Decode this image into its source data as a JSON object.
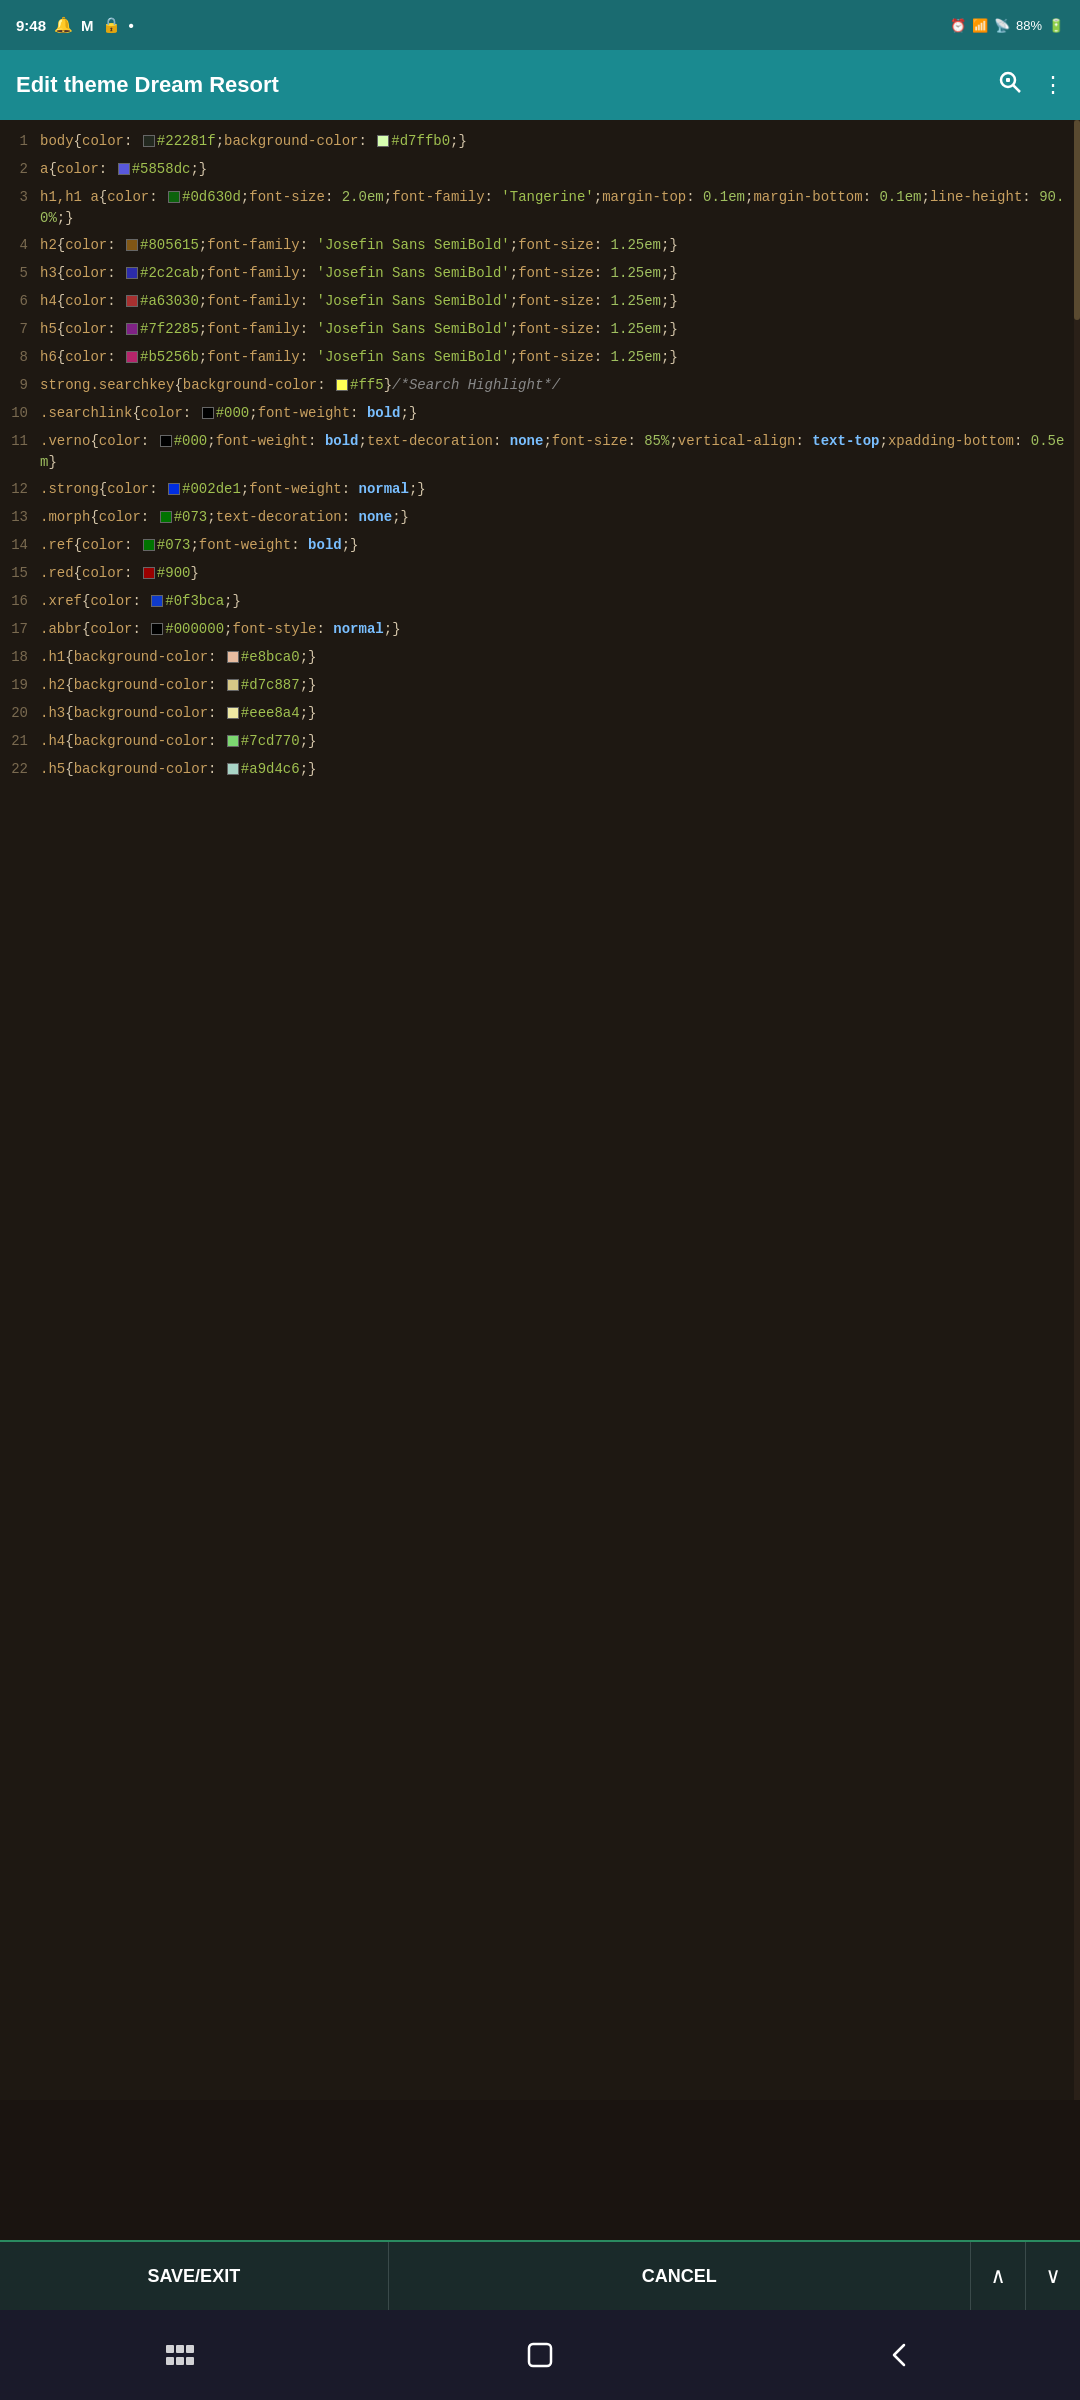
{
  "statusBar": {
    "time": "9:48",
    "battery": "88%",
    "icons": [
      "alarm",
      "wifi",
      "signal"
    ]
  },
  "header": {
    "title": "Edit theme Dream Resort",
    "searchIcon": "🔍",
    "menuIcon": "⋮"
  },
  "toolbar": {
    "saveLabel": "SAVE/EXIT",
    "cancelLabel": "CANCEL",
    "upIcon": "^",
    "downIcon": "v"
  },
  "lines": [
    {
      "num": "1",
      "swatches": [
        {
          "color": "#22281f",
          "pos": 0
        },
        {
          "color": "#d7ffb0",
          "pos": 1
        }
      ],
      "text": "body{color: #22281f;background-color: #d7ffb0;}"
    },
    {
      "num": "2",
      "swatches": [
        {
          "color": "#5858dc",
          "pos": 0
        }
      ],
      "text": "a{color: #5858dc;}"
    },
    {
      "num": "3",
      "swatches": [
        {
          "color": "#0d630d",
          "pos": 0
        }
      ],
      "text": "h1,h1 a{color: #0d630d;font-size:2.0em;font-family:'Tangerine';margin-top:0.1em;margin-bottom:0.1em;line-height:90.0%;}"
    },
    {
      "num": "4",
      "swatches": [
        {
          "color": "#805615",
          "pos": 0
        }
      ],
      "text": "h2{color: #805615;font-family:'Josefin Sans SemiBold';font-size:1.25em;}"
    },
    {
      "num": "5",
      "swatches": [
        {
          "color": "#2c2cab",
          "pos": 0
        }
      ],
      "text": "h3{color: #2c2cab;font-family:'Josefin Sans SemiBold';font-size:1.25em;}"
    },
    {
      "num": "6",
      "swatches": [
        {
          "color": "#a63030",
          "pos": 0
        }
      ],
      "text": "h4{color: #a63030;font-family:'Josefin Sans SemiBold';font-size:1.25em;}"
    },
    {
      "num": "7",
      "swatches": [
        {
          "color": "#7f2285",
          "pos": 0
        }
      ],
      "text": "h5{color: #7f2285;font-family:'Josefin Sans SemiBold';font-size:1.25em;}"
    },
    {
      "num": "8",
      "swatches": [
        {
          "color": "#b5256b",
          "pos": 0
        }
      ],
      "text": "h6{color: #b5256b;font-family:'Josefin Sans SemiBold';font-size:1.25em;}"
    },
    {
      "num": "9",
      "swatches": [
        {
          "color": "#ffff55",
          "pos": 0
        }
      ],
      "text": "strong.searchkey{background-color: #ff5}/*Search Highlight*/"
    },
    {
      "num": "10",
      "swatches": [
        {
          "color": "#000000",
          "pos": 0
        }
      ],
      "text": ".searchlink{color: #000;font-weight:bold;}"
    },
    {
      "num": "11",
      "swatches": [
        {
          "color": "#000000",
          "pos": 0
        }
      ],
      "text": ".verno{color: #000;font-weight:bold;text-decoration:none;font-size:85%;vertical-align:text-top;xpadding-bottom:0.5em}"
    },
    {
      "num": "12",
      "swatches": [
        {
          "color": "#002de1",
          "pos": 0
        }
      ],
      "text": ".strong{color: #002de1;font-weight:normal;}"
    },
    {
      "num": "13",
      "swatches": [
        {
          "color": "#007300",
          "pos": 0
        }
      ],
      "text": ".morph{color: #073;text-decoration:none;}"
    },
    {
      "num": "14",
      "swatches": [
        {
          "color": "#007300",
          "pos": 0
        }
      ],
      "text": ".ref{color: #073;font-weight:bold;}"
    },
    {
      "num": "15",
      "swatches": [
        {
          "color": "#990000",
          "pos": 0
        }
      ],
      "text": ".red{color: #900}"
    },
    {
      "num": "16",
      "swatches": [
        {
          "color": "#0f3bca",
          "pos": 0
        }
      ],
      "text": ".xref{color: #0f3bca;}"
    },
    {
      "num": "17",
      "swatches": [
        {
          "color": "#000000",
          "pos": 0
        }
      ],
      "text": ".abbr{color: #000000;font-style:normal;}"
    },
    {
      "num": "18",
      "swatches": [
        {
          "color": "#e8bca0",
          "pos": 0
        }
      ],
      "text": ".h1{background-color: #e8bca0;}"
    },
    {
      "num": "19",
      "swatches": [
        {
          "color": "#d7c887",
          "pos": 0
        }
      ],
      "text": ".h2{background-color: #d7c887;}"
    },
    {
      "num": "20",
      "swatches": [
        {
          "color": "#eee8a4",
          "pos": 0
        }
      ],
      "text": ".h3{background-color: #eee8a4;}"
    },
    {
      "num": "21",
      "swatches": [
        {
          "color": "#7cd770",
          "pos": 0
        }
      ],
      "text": ".h4{background-color: #7cd770;}"
    },
    {
      "num": "22",
      "swatches": [
        {
          "color": "#a9d4c6",
          "pos": 0
        }
      ],
      "text": ".h5{background-color: #a9d4c6;}"
    }
  ]
}
